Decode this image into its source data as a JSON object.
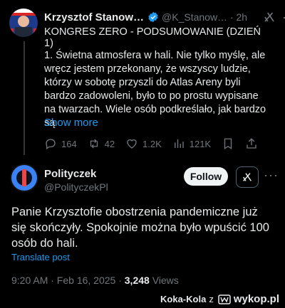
{
  "original_tweet": {
    "author_name": "Krzysztof Stanow…",
    "handle_time": "@K_Stanow… · 2h",
    "heading": "KONGRES ZERO - PODSUMOWANIE (DZIEŃ 1)",
    "body": "1. Świetna atmosfera w hali. Nie tylko myślę, ale wręcz jestem przekonany, że wszyscy ludzie, którzy w sobotę przyszli do Atlas Areny byli bardzo zadowoleni, było to po prostu wypisane na twarzach. Wiele osób podkreślało, jak bardzo są",
    "show_more": "Show more",
    "replies": "164",
    "reposts": "42",
    "likes": "1.2K",
    "views": "121K"
  },
  "reply": {
    "author_name": "Polityczek",
    "handle": "@PolityczekPl",
    "follow_label": "Follow",
    "text": "Panie Krzysztofie obostrzenia pandemiczne już się skończyły. Spokojnie można było wpuścić 100 osób do hali.",
    "translate": "Translate post",
    "timestamp": "9:20 AM · Feb 16, 2025 · ",
    "views_count": "3,248",
    "views_label": " Views"
  },
  "watermark": {
    "user": "Koka-Kola",
    "separator": "z",
    "site": "wykop.pl"
  },
  "colors": {
    "accent": "#1d9bf0",
    "muted": "#71767b"
  }
}
